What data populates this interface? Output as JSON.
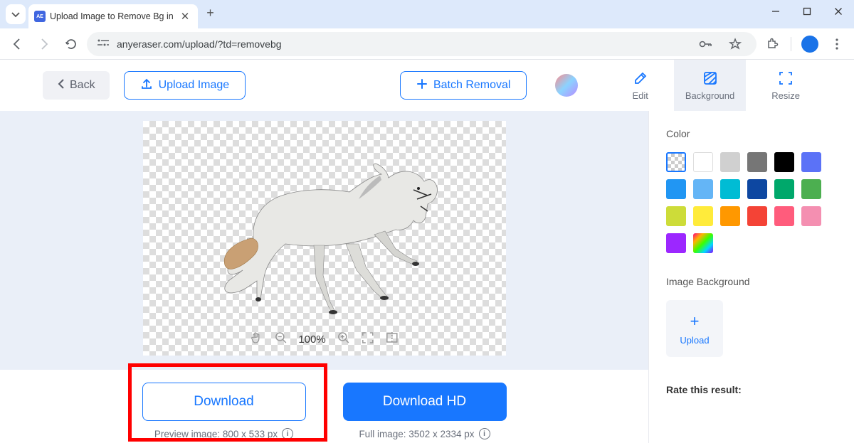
{
  "browser": {
    "tab_title": "Upload Image to Remove Bg in",
    "favicon_text": "AE",
    "url": "anyeraser.com/upload/?td=removebg"
  },
  "header": {
    "back_label": "Back",
    "upload_label": "Upload Image",
    "batch_label": "Batch Removal",
    "tool_edit": "Edit",
    "tool_background": "Background",
    "tool_resize": "Resize"
  },
  "canvas": {
    "zoom": "100%"
  },
  "download": {
    "left_label": "Download",
    "left_meta": "Preview image: 800 x 533 px",
    "right_label": "Download HD",
    "right_meta": "Full image: 3502 x 2334 px"
  },
  "sidebar": {
    "color_label": "Color",
    "bg_label": "Image Background",
    "upload_label": "Upload",
    "rate_label": "Rate this result:",
    "colors": [
      {
        "id": "transparent",
        "class": "transparent"
      },
      {
        "id": "white",
        "class": "white"
      },
      {
        "id": "lightgray",
        "hex": "#d0d0d0"
      },
      {
        "id": "gray",
        "hex": "#767676"
      },
      {
        "id": "black",
        "hex": "#000000"
      },
      {
        "id": "indigo",
        "hex": "#5b72f7"
      },
      {
        "id": "blue",
        "hex": "#2196f3"
      },
      {
        "id": "skyblue",
        "hex": "#64b5f6"
      },
      {
        "id": "cyan",
        "hex": "#00bcd4"
      },
      {
        "id": "navy",
        "hex": "#0d47a1"
      },
      {
        "id": "teal",
        "hex": "#00a86b"
      },
      {
        "id": "green",
        "hex": "#4caf50"
      },
      {
        "id": "lime",
        "hex": "#cddc39"
      },
      {
        "id": "yellow",
        "hex": "#ffeb3b"
      },
      {
        "id": "orange",
        "hex": "#ff9800"
      },
      {
        "id": "red",
        "hex": "#f44336"
      },
      {
        "id": "pink",
        "hex": "#ff5c7c"
      },
      {
        "id": "lightpink",
        "hex": "#f48fb1"
      },
      {
        "id": "purple",
        "hex": "#9c27ff"
      },
      {
        "id": "rainbow",
        "class": "rainbow"
      }
    ]
  }
}
